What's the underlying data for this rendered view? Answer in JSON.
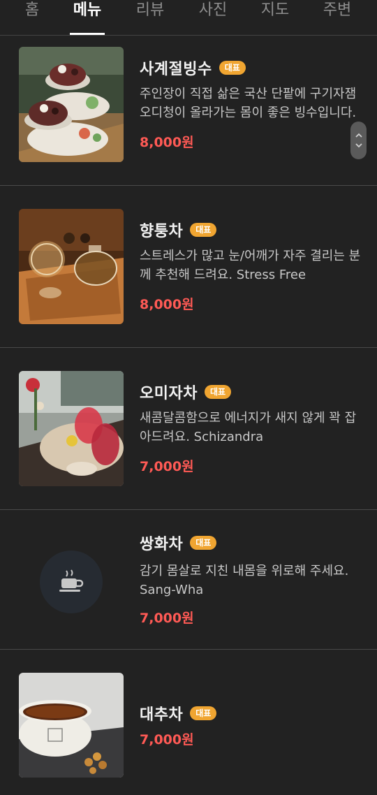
{
  "tabs": [
    {
      "label": "홈"
    },
    {
      "label": "메뉴"
    },
    {
      "label": "리뷰"
    },
    {
      "label": "사진"
    },
    {
      "label": "지도"
    },
    {
      "label": "주변"
    }
  ],
  "active_tab": "메뉴",
  "badge_label": "대표",
  "items": [
    {
      "name": "사계절빙수",
      "description": "주인장이 직접 삶은 국산 단팥에 구기자잼 오디청이 올라가는 몸이 좋은 빙수입니다.",
      "price": "8,000원",
      "image": "bingsu-photo"
    },
    {
      "name": "향퉁차",
      "description": "스트레스가 많고 눈/어깨가 자주 결리는 분께 추천해 드려요. Stress Free",
      "price": "8,000원",
      "image": "teapot-photo"
    },
    {
      "name": "오미자차",
      "description": "새콤달콤함으로 에너지가 새지 않게 꽉 잡아드려요. Schizandra",
      "price": "7,000원",
      "image": "omija-photo"
    },
    {
      "name": "쌍화차",
      "description": "감기 몸살로 지친 내몸을 위로해 주세요. Sang-Wha",
      "price": "7,000원",
      "image": "coffee-cup-icon"
    },
    {
      "name": "대추차",
      "description": "",
      "price": "7,000원",
      "image": "jujube-tea-photo"
    }
  ],
  "colors": {
    "background": "#222222",
    "accent_price": "#ff5a55",
    "badge": "#f0a531"
  }
}
